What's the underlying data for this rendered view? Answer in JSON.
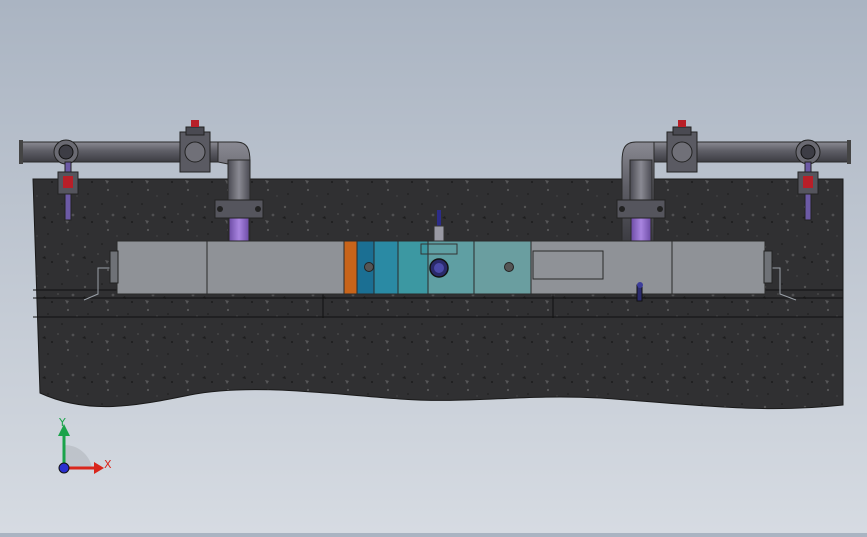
{
  "triad": {
    "x_label": "X",
    "y_label": "Y",
    "x_color": "#d9261c",
    "y_color": "#1aa34a",
    "z_color": "#2a2fcf"
  },
  "colors": {
    "background_top": "#aab4c2",
    "concrete": "#2f2f31",
    "pipe": "#5e5e66",
    "pipe_highlight": "#8e62c9",
    "channel_gray": "#8f9297",
    "segment_orange": "#c8641a",
    "segment_blue_1": "#1b6f93",
    "segment_blue_2": "#2a8aa4",
    "segment_teal_1": "#3c98a2",
    "segment_teal_2": "#5f9fa3",
    "valve_red": "#b81f28"
  }
}
